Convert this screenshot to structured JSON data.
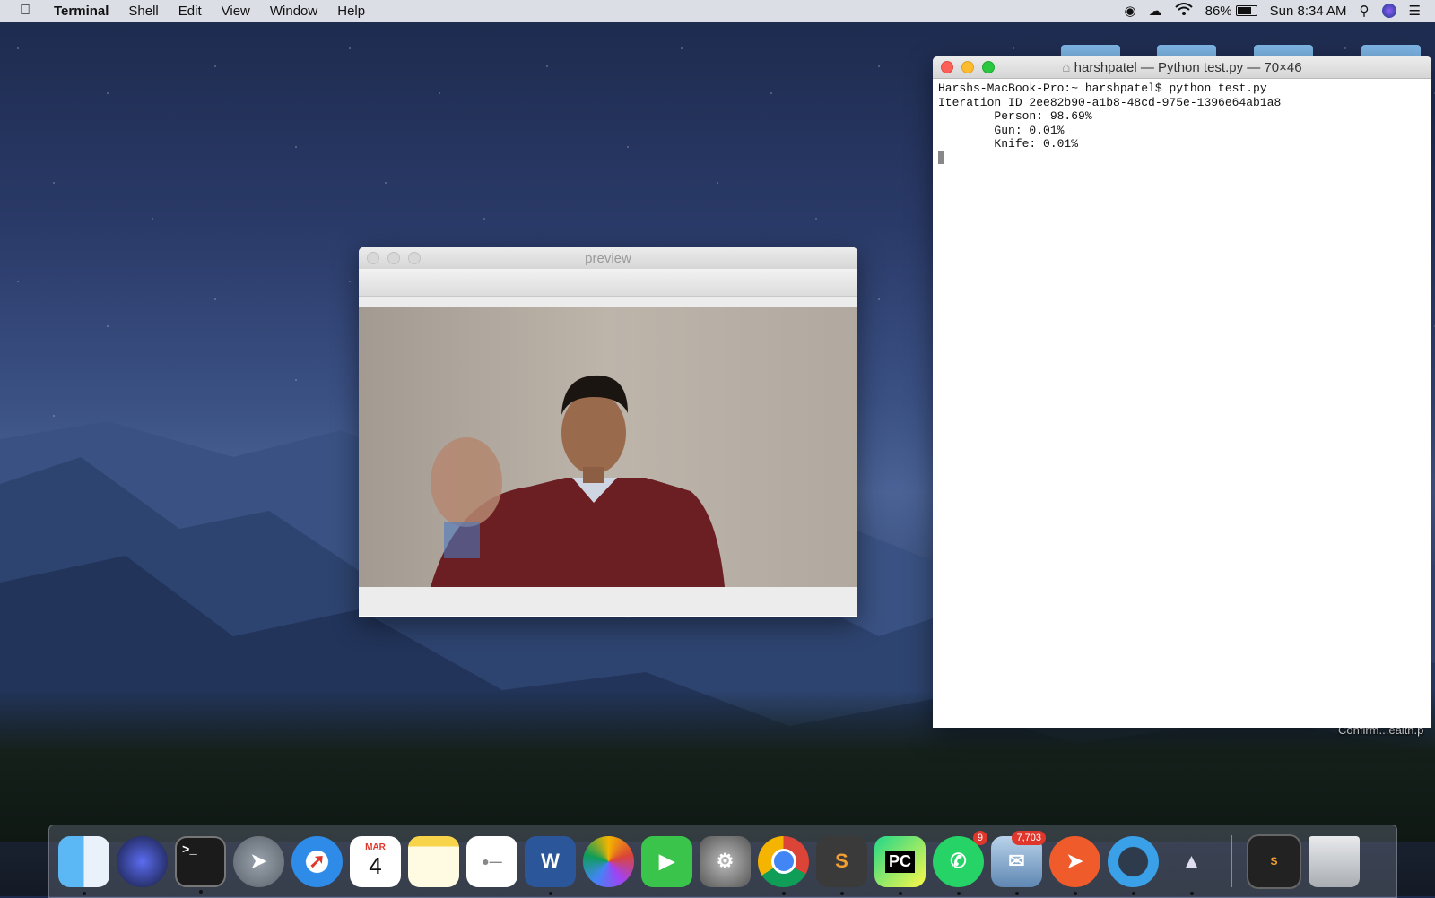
{
  "menubar": {
    "app_name": "Terminal",
    "items": [
      "Shell",
      "Edit",
      "View",
      "Window",
      "Help"
    ],
    "battery_percent": "86%",
    "battery_level": 0.86,
    "clock": "Sun 8:34 AM"
  },
  "terminal": {
    "title": "harshpatel — Python test.py — 70×46",
    "lines": [
      "Harshs-MacBook-Pro:~ harshpatel$ python test.py",
      "Iteration ID 2ee82b90-a1b8-48cd-975e-1396e64ab1a8",
      "        Person: 98.69%",
      "        Gun: 0.01%",
      "        Knife: 0.01%"
    ]
  },
  "preview": {
    "title": "preview"
  },
  "desktop": {
    "file_label": "Confirm...ealth.p"
  },
  "dock": {
    "calendar_month": "MAR",
    "calendar_day": "4",
    "whatsapp_badge": "9",
    "mail_badge": "7,703"
  }
}
